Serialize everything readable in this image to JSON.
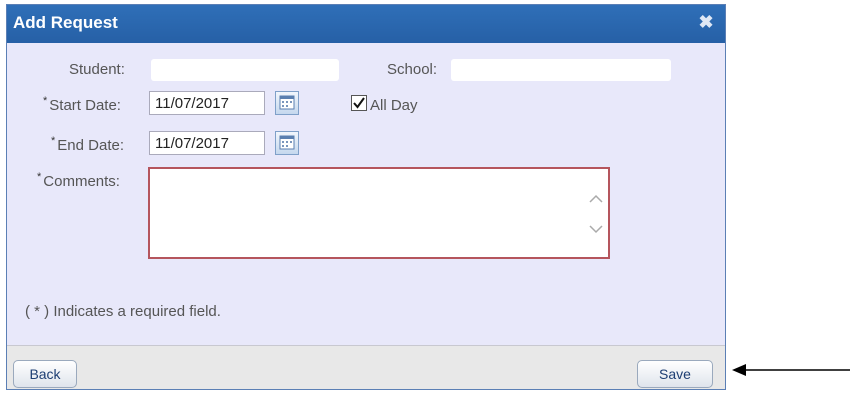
{
  "dialog": {
    "title": "Add Request",
    "close_icon": "close-x-icon"
  },
  "fields": {
    "student_label": "Student:",
    "school_label": "School:",
    "start_date_label": "Start Date:",
    "start_date_value": "11/07/2017",
    "all_day_label": "All Day",
    "all_day_checked": true,
    "end_date_label": "End Date:",
    "end_date_value": "11/07/2017",
    "comments_label": "Comments:",
    "required_marker": "*"
  },
  "hint": {
    "text": "( * ) Indicates a required field."
  },
  "footer": {
    "back_label": "Back",
    "save_label": "Save"
  },
  "colors": {
    "titlebar": "#2660a6",
    "dialog_bg": "#e8e8fa",
    "error_border": "#b5555d"
  }
}
